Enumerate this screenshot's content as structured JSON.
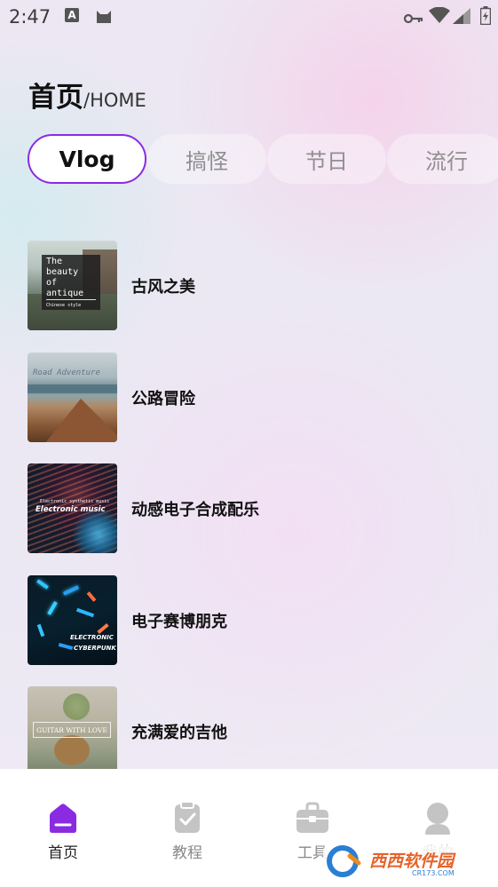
{
  "status_bar": {
    "time": "2:47",
    "notification_letter": "A"
  },
  "header": {
    "title_cn": "首页",
    "title_en": "/HOME"
  },
  "tabs": [
    {
      "label": "Vlog",
      "active": true
    },
    {
      "label": "搞怪",
      "active": false
    },
    {
      "label": "节日",
      "active": false
    },
    {
      "label": "流行",
      "active": false
    }
  ],
  "items": [
    {
      "title": "古风之美",
      "thumb_text": [
        "The",
        "beauty",
        "of",
        "antique"
      ],
      "thumb_subtext": "Chinese style"
    },
    {
      "title": "公路冒险",
      "thumb_text": "Road Adventure"
    },
    {
      "title": "动感电子合成配乐",
      "thumb_subtext": "Electronic synthetic music",
      "thumb_text": "Electronic music"
    },
    {
      "title": "电子赛博朋克",
      "thumb_text": [
        "ELECTRONIC",
        "CYBERPUNK"
      ]
    },
    {
      "title": "充满爱的吉他",
      "thumb_text": "GUITAR WITH LOVE"
    }
  ],
  "bottom_nav": [
    {
      "label": "首页",
      "icon": "home-icon",
      "active": true
    },
    {
      "label": "教程",
      "icon": "checklist-icon",
      "active": false
    },
    {
      "label": "工具",
      "icon": "toolbox-icon",
      "active": false
    },
    {
      "label": "我的",
      "icon": "user-icon",
      "active": false
    }
  ],
  "watermark": {
    "text": "西西软件园",
    "sub": "CR173.COM"
  },
  "colors": {
    "accent": "#8a2be2",
    "nav_active": "#8a2be2",
    "nav_inactive": "#c4c4c4"
  }
}
